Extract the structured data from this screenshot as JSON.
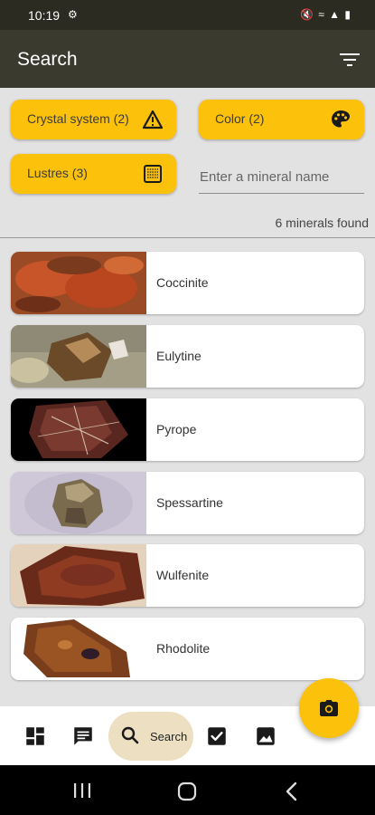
{
  "status_bar": {
    "time": "10:19",
    "settings_icon": "gear-icon",
    "right_icons": "🔇 ≈ ▲ ▮"
  },
  "app_bar": {
    "title": "Search",
    "filter_icon": "filter-lines-icon"
  },
  "filters": {
    "crystal_system": "Crystal system (2)",
    "color": "Color (2)",
    "lustres": "Lustres (3)",
    "name_placeholder": "Enter a mineral name",
    "name_value": ""
  },
  "results": {
    "count_text": "6 minerals found"
  },
  "minerals": [
    {
      "name": "Coccinite"
    },
    {
      "name": "Eulytine"
    },
    {
      "name": "Pyrope"
    },
    {
      "name": "Spessartine"
    },
    {
      "name": "Wulfenite"
    },
    {
      "name": "Rhodolite"
    }
  ],
  "bottom_nav": {
    "active_label": "Search"
  },
  "colors": {
    "accent": "#fcc10a",
    "app_bar": "#3a3a2e",
    "status_bar": "#2b2b21",
    "background": "#e2e2e2",
    "nav_active": "#ede0c2"
  }
}
